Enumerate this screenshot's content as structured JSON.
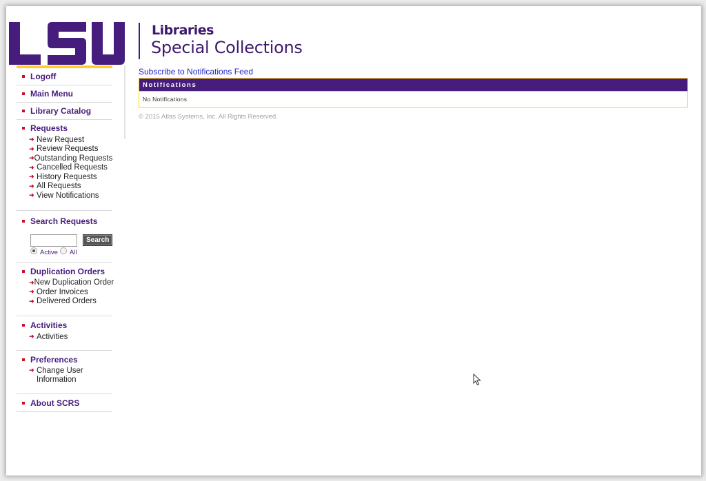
{
  "header": {
    "logo_mark": "LSU",
    "logo_line1": "Libraries",
    "logo_line2": "Special Collections"
  },
  "sidebar": {
    "sections": [
      {
        "label": "Logoff"
      },
      {
        "label": "Main Menu"
      },
      {
        "label": "Library Catalog"
      },
      {
        "label": "Requests",
        "items": [
          "New Request",
          "Review Requests",
          "Outstanding Requests",
          "Cancelled Requests",
          "History Requests",
          "All Requests",
          "View Notifications"
        ]
      },
      {
        "label": "Search Requests",
        "search": {
          "input_value": "",
          "button_label": "Search",
          "radio_active_label": "Active",
          "radio_all_label": "All",
          "selected": "Active"
        }
      },
      {
        "label": "Duplication Orders",
        "items": [
          "New Duplication Order",
          "Order Invoices",
          "Delivered Orders"
        ]
      },
      {
        "label": "Activities",
        "items": [
          "Activities"
        ]
      },
      {
        "label": "Preferences",
        "items": [
          "Change User Information"
        ]
      },
      {
        "label": "About SCRS"
      }
    ]
  },
  "main": {
    "feed_link": "Subscribe to Notifications Feed",
    "notifications": {
      "title": "Notifications",
      "empty_text": "No Notifications"
    },
    "copyright": "© 2015 Atlas Systems, Inc. All Rights Reserved."
  },
  "colors": {
    "brand_purple": "#461d7c",
    "brand_gold": "#fdd023",
    "bullet_red": "#c8102e",
    "link_blue": "#2020c8"
  }
}
